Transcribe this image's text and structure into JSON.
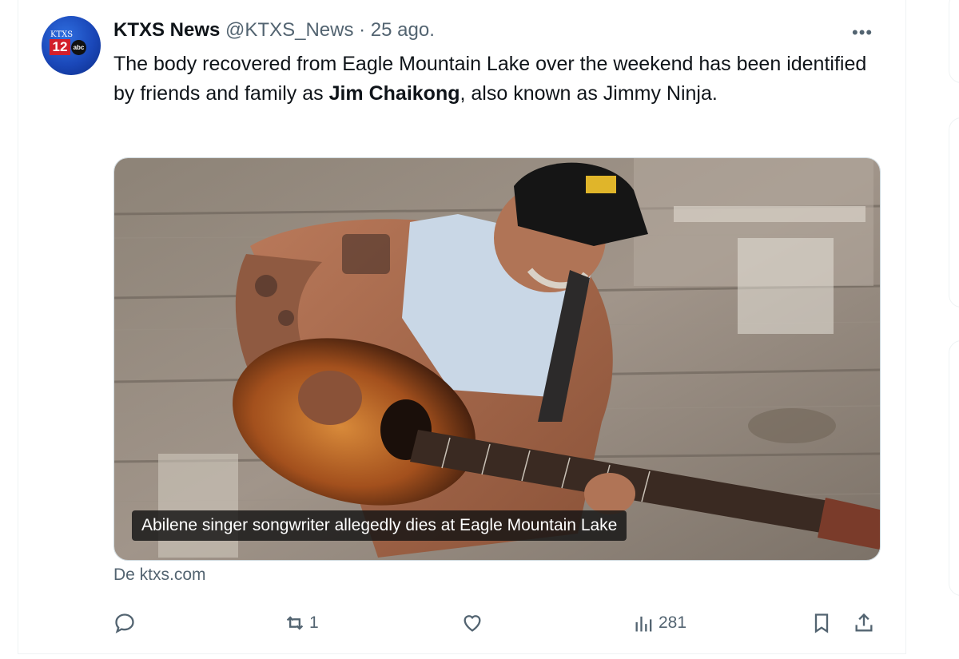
{
  "tweet": {
    "author_name": "KTXS News",
    "handle": "@KTXS_News",
    "separator": " · ",
    "time": "25 ago.",
    "more_icon": "more-horizontal-icon",
    "avatar": {
      "callsign": "KTXS",
      "channel": "12",
      "network": "abc"
    },
    "text_part1": "The body recovered from Eagle Mountain Lake over the weekend has been identified by friends and family as ",
    "text_bold": "Jim Chaikong",
    "text_part2": ", also known as Jimmy Ninja.",
    "media": {
      "caption": "Abilene singer songwriter allegedly dies at Eagle Mountain Lake",
      "description_icon": "photo-of-man-playing-guitar"
    },
    "source": "De ktxs.com",
    "actions": {
      "reply": {
        "icon": "reply-icon",
        "count": ""
      },
      "retweet": {
        "icon": "retweet-icon",
        "count": "1"
      },
      "like": {
        "icon": "heart-icon",
        "count": ""
      },
      "views": {
        "icon": "views-icon",
        "count": "281"
      },
      "bookmark": {
        "icon": "bookmark-icon"
      },
      "share": {
        "icon": "share-icon"
      }
    }
  },
  "colors": {
    "text": "#0f1419",
    "muted": "#536471",
    "border": "#eff3f4"
  }
}
